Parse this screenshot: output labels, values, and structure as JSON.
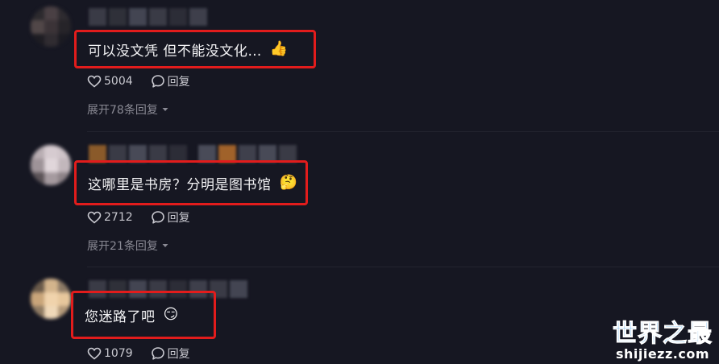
{
  "comments": [
    {
      "text": "可以没文凭 但不能没文化…",
      "emoji": "👍",
      "likes": "5004",
      "reply_label": "回复",
      "expand_label": "展开78条回复"
    },
    {
      "text": "这哪里是书房？分明是图书馆",
      "emoji": "🤔",
      "likes": "2712",
      "reply_label": "回复",
      "expand_label": "展开21条回复"
    },
    {
      "text": "您迷路了吧",
      "emoji": "😏",
      "likes": "1079",
      "reply_label": "回复"
    }
  ],
  "watermark": {
    "title": "世界之最",
    "subtitle": "shijiezz.com"
  },
  "colors": {
    "background": "#161722",
    "highlight_border": "#e21c1c",
    "text_primary": "#f2f2f4",
    "text_secondary": "#8a8a94",
    "watermark_blue": "#1d8ce8"
  }
}
